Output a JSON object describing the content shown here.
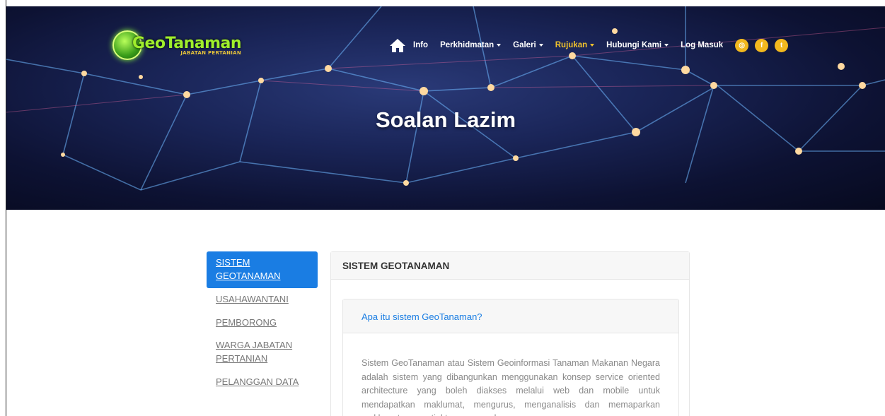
{
  "logo": {
    "text": "GeoTanaman",
    "subtitle": "JABATAN PERTANIAN"
  },
  "nav": {
    "items": [
      {
        "label": "Info",
        "has_dropdown": false,
        "active": false
      },
      {
        "label": "Perkhidmatan",
        "has_dropdown": true,
        "active": false
      },
      {
        "label": "Galeri",
        "has_dropdown": true,
        "active": false
      },
      {
        "label": "Rujukan",
        "has_dropdown": true,
        "active": true
      },
      {
        "label": "Hubungi Kami",
        "has_dropdown": true,
        "active": false
      },
      {
        "label": "Log Masuk",
        "has_dropdown": false,
        "active": false
      }
    ],
    "social": [
      "instagram-icon",
      "facebook-icon",
      "twitter-icon"
    ]
  },
  "hero": {
    "title": "Soalan Lazim"
  },
  "sidebar": {
    "items": [
      {
        "label": "SISTEM GEOTANAMAN",
        "active": true
      },
      {
        "label": "USAHAWANTANI",
        "active": false
      },
      {
        "label": "PEMBORONG",
        "active": false
      },
      {
        "label": "WARGA JABATAN PERTANIAN",
        "active": false
      },
      {
        "label": "PELANGGAN DATA",
        "active": false
      }
    ]
  },
  "main": {
    "header": "SISTEM GEOTANAMAN",
    "faq": {
      "question": "Apa itu sistem GeoTanaman?",
      "answer": "Sistem GeoTanaman atau Sistem Geoinformasi Tanaman Makanan Negara adalah sistem yang dibangunkan menggunakan konsep service oriented architecture yang boleh diakses melalui web dan mobile untuk mendapatkan maklumat, mengurus, menganalisis dan memaparkan maklumat geospatial tanaman makanan negara."
    }
  },
  "colors": {
    "accent": "#1a7de3",
    "nav_active": "#f0c22c",
    "social": "#f2b81e",
    "logo_green": "#9fee2c"
  }
}
